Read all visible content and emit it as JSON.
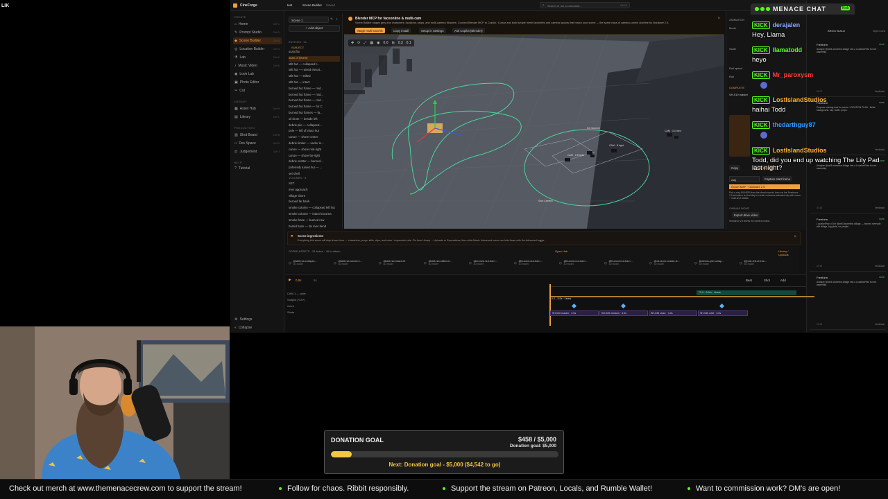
{
  "stream_label": "LIK",
  "app": {
    "name": "CineForge",
    "tab": "test",
    "crumb": "Scene Builder",
    "crumb_status": "Saved",
    "search_placeholder": "Search or run a command...",
    "search_kbd": "Ctrl+K",
    "scene_selector": "Scene 1",
    "add_object": "Add object",
    "sidebar": {
      "sections": [
        "CREATE",
        "LIBRARY",
        "PRODUCTION",
        "HELP"
      ],
      "create_items": [
        {
          "label": "Home",
          "kbd": "Ctrl+1"
        },
        {
          "label": "Prompt Studio",
          "kbd": "Ctrl+2"
        },
        {
          "label": "Scene Builder",
          "kbd": "Ctrl+3"
        },
        {
          "label": "Location Builder",
          "kbd": "Ctrl+4"
        },
        {
          "label": "Lab",
          "kbd": "Ctrl+5"
        },
        {
          "label": "Music Video",
          "kbd": "Ctrl+6"
        },
        {
          "label": "Look Lab",
          "kbd": ""
        },
        {
          "label": "Photo Editor",
          "kbd": ""
        },
        {
          "label": "Cut",
          "kbd": ""
        }
      ],
      "library_items": [
        {
          "label": "Asset Hub",
          "kbd": "Ctrl+H"
        },
        {
          "label": "Library",
          "kbd": "Ctrl+L"
        }
      ],
      "production_items": [
        {
          "label": "Shot Board",
          "kbd": "Ctrl+B"
        },
        {
          "label": "Dev Space",
          "kbd": "Ctrl+D"
        },
        {
          "label": "Judgement",
          "kbd": "Ctrl+J"
        }
      ],
      "help_items": [
        {
          "label": "Tutorial"
        }
      ],
      "bottom_items": [
        {
          "label": "Settings"
        },
        {
          "label": "Collapse"
        }
      ]
    },
    "entities": {
      "header": "ENTITIES · 21",
      "subject_label": "SUBJECT",
      "rows": [
        "scan.fbx",
        "scan of (0.0m)",
        "stilt hut — collapsed t...",
        "stilt hut — ruined elevat...",
        "stilt hut — stilted",
        "stilt hut — intact",
        "burned hut frame — mid...",
        "burned hut frame — mid...",
        "burned hut frame — mid...",
        "burned hut frame — for C",
        "burned hut frames — fa...",
        "oil drum — beside left",
        "debris pile — collapsed...",
        "pole — left of intact hut",
        "canoe — shore center",
        "debris timber — under in...",
        "canoe — shore mid-right",
        "canoe — shore far-right",
        "debris scatter — burned...",
        "(Inferred) ruined hut — ...",
        "set shell"
      ],
      "volumes_header": "VOLUMES · 8",
      "volumes": [
        "SET",
        "river approach",
        "village shore",
        "burned far bank",
        "smoke column — collapsed left hut",
        "smoke column — intact hut area",
        "smoke haze — burned row",
        "humid haze — far river bend"
      ]
    },
    "banner": {
      "title": "Blender MCP for faceonline & multi-cam",
      "body": "Scene Builder stages grey-box characters, locations, props, and multi-camera blockers. Connect Blender MCP to Copilot / Cursor and build simple mesh facsimiles and camera layouts that match your scene — the same class of camera-control doctrine by Noctware 2.5.",
      "buttons": [
        "Stage multi-cam kit",
        "Copy install",
        "Setup in Settings",
        "Ask Copilot (Blender)"
      ]
    },
    "viewport": {
      "toolbar_values": [
        "0.0",
        "0.3",
        "0.1"
      ],
      "labels": [
        "Set Scanner",
        "CAM · 2.8 wide",
        "CAM · B tight",
        "Shot Camera",
        "CAM · 3.4 med"
      ]
    },
    "ingredients": {
      "title": "Scene ingredients",
      "body": "Everything this scene will stay shown here — characters, props, stills, clips, and voice / expression refs. Pin from Library → Uploads or Generations, then click Attach. Advanced users can hide those with the Advanced toggle."
    },
    "scene_assets": {
      "header": "SCENE ASSETS · 24 linked · 48 to attach",
      "open_hub": "Open Hub",
      "library_link": "Library / Uploads",
      "items": [
        {
          "name": "@stilt-hut-collapse...",
          "kind": "3D model"
        },
        {
          "name": "@stilt-hut-ruined-e...",
          "kind": "3D model"
        },
        {
          "name": "@stilt-hut-intact-22",
          "kind": "3D model"
        },
        {
          "name": "@stilt-hut-stilted-2...",
          "kind": "3D model"
        },
        {
          "name": "@burned-hut-fram...",
          "kind": "3D model"
        },
        {
          "name": "@burned-hut-fram...",
          "kind": "3D model"
        },
        {
          "name": "@burned-hut-fram...",
          "kind": "3D model"
        },
        {
          "name": "@burned-hut-fram...",
          "kind": "3D model"
        },
        {
          "name": "@oil-drum-beside-le...",
          "kind": "3D model"
        },
        {
          "name": "@debris-pile-collap...",
          "kind": "3D model"
        },
        {
          "name": "@pole-left-of-inta...",
          "kind": "3D model"
        }
      ]
    },
    "timeline": {
      "time": "0.0s",
      "end": "5s",
      "tracks": [
        "CAM 1 — wide",
        "Subject (Y-B+)",
        "rivers",
        "Shots"
      ],
      "clip_ref": "0.0→5.0s · Linear",
      "clip_top": "72.0→9.0m · Linear",
      "shots": [
        "SH-010 master · 4.0s",
        "SH-020 medium · 4.0s",
        "SH-030 close · 4.0s",
        "SH-040 orbit · 3.0s"
      ],
      "controls": [
        "Beat",
        "Shot",
        "Add"
      ]
    },
    "right_panel": {
      "header": "ANIMATION",
      "labels": [
        "Mode",
        "Scale",
        "Roll speed",
        "Roll"
      ],
      "complete": "COMPLETE",
      "sh_label": "SH-010 master",
      "copy": "Copy",
      "export_btn": "Export Blender",
      "select": "clay",
      "capture": "Capture start frame",
      "export_notice": "Export MAP · Noctware 2.5",
      "text": "Pick a clay IBL/HDRI from the blend exports, then run the Seedance 2.5 animation on that clay to create a camera-animated clip with scene + multi-shot details.",
      "canvas_label": "CANVAS MOVE",
      "drive_btn": "Export drive video",
      "drive_text": "Seedance 2.5 drives the camera motion."
    },
    "farright": {
      "tabs": [
        "CHAT",
        "BRICK BUILD",
        "Open new"
      ],
      "entries": [
        {
          "title": "Freeform",
          "time": "00:07",
          "lines": "Analyze @set3-shoreline-village into a LocationPlan for set assembly."
        },
        {
          "title": "Freeform",
          "time": "00:11",
          "lines": "Propose missing look for scene. LOCATION PLAN - fields: background, sky, water, props."
        },
        {
          "title": "Freeform",
          "time": "00:14",
          "lines": "Analyze @set3-shoreline-village into a LocationPlan for set assembly."
        },
        {
          "title": "Freeform",
          "time": "00:19",
          "lines": "LocationPlan v2 for @set3-shoreline-village — burned riverside stilt village, fog plate, no people."
        },
        {
          "title": "Freeform",
          "time": "00:22",
          "lines": "Analyze @set3-shoreline-village into a LocationPlan for set assembly."
        }
      ],
      "feedback": "feedback",
      "done": "done"
    }
  },
  "chat": {
    "title": "MENACE CHAT",
    "badge": "Kick",
    "platform": "KICK",
    "messages": [
      {
        "user": "derajalen",
        "color": "#8aa8ff",
        "text": "Hey, Llama"
      },
      {
        "user": "llamatodd",
        "color": "#53fc18",
        "text": "heyo"
      },
      {
        "user": "Mr_paroxysm",
        "color": "#ff3b3b",
        "text": ""
      },
      {
        "user": "LostIslandStudios",
        "color": "#ffb02e",
        "text": "haihai Todd"
      },
      {
        "user": "thedarthguy87",
        "color": "#2e9bff",
        "text": ""
      },
      {
        "user": "LostIslandStudios",
        "color": "#ffb02e",
        "text": "Todd, did you end up watching The Lily Pad last night?"
      }
    ]
  },
  "donation": {
    "title": "DONATION GOAL",
    "amount": "$458 / $5,000",
    "sub": "Donation goal: $5,000",
    "progress": 0.0916,
    "next": "Next: Donation goal - $5,000 ($4,542 to go)"
  },
  "ticker": [
    "Check out merch at www.themenacecrew.com to support the stream!",
    "Follow for chaos. Ribbit responsibly.",
    "Support the stream on Patreon, Locals, and Rumble Wallet!",
    "Want to commission work? DM's are open!"
  ],
  "colors": {
    "accent": "#f0a040",
    "kick": "#53fc18",
    "gold": "#f3c744"
  }
}
